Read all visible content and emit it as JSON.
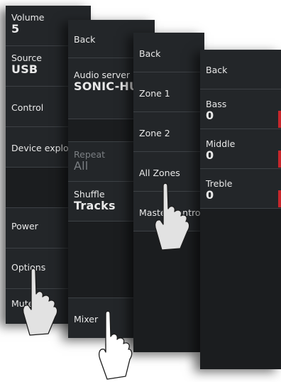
{
  "panel1": {
    "items": [
      {
        "label": "Volume",
        "value": "5"
      },
      {
        "label": "Source",
        "value": "USB"
      },
      {
        "label": "Control"
      },
      {
        "label": "Device explorer"
      },
      {
        "label": "Power"
      },
      {
        "label": "Options"
      },
      {
        "label": "Mute"
      }
    ]
  },
  "panel2": {
    "items": [
      {
        "label": "Back"
      },
      {
        "label": "Audio server",
        "value": "SONIC-HUB"
      },
      {
        "label": "Repeat",
        "value": "All"
      },
      {
        "label": "Shuffle",
        "value": "Tracks"
      },
      {
        "label": "Mixer"
      }
    ]
  },
  "panel3": {
    "items": [
      {
        "label": "Back"
      },
      {
        "label": "Zone 1"
      },
      {
        "label": "Zone 2"
      },
      {
        "label": "All Zones"
      },
      {
        "label": "Master control"
      }
    ]
  },
  "panel4": {
    "items": [
      {
        "label": "Back"
      },
      {
        "label": "Bass",
        "value": "0"
      },
      {
        "label": "Middle",
        "value": "0"
      },
      {
        "label": "Treble",
        "value": "0"
      }
    ]
  },
  "colors": {
    "panel_bg": "#232629",
    "text": "#e9e9e9",
    "disabled_text": "#7b7f83",
    "accent_marker": "#c8262b"
  }
}
